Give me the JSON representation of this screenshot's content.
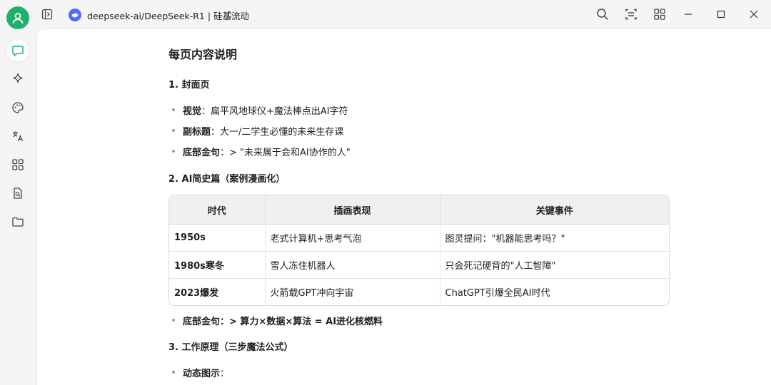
{
  "header": {
    "model_name": "deepseek-ai/DeepSeek-R1 | 硅基流动"
  },
  "doc": {
    "title": "每页内容说明",
    "section1": {
      "heading": "1. 封面页",
      "bullets": [
        {
          "label": "视觉",
          "text": "：扁平风地球仪+魔法棒点出AI字符"
        },
        {
          "label": "副标题",
          "text": "：大一/二学生必懂的未来生存课"
        },
        {
          "label": "底部金句",
          "text": "：> \"未来属于会和AI协作的人\""
        }
      ]
    },
    "section2": {
      "heading": "2. AI简史篇（案例漫画化）",
      "table": {
        "headers": [
          "时代",
          "插画表现",
          "关键事件"
        ],
        "rows": [
          [
            "1950s",
            "老式计算机+思考气泡",
            "图灵提问：\"机器能思考吗？\""
          ],
          [
            "1980s寒冬",
            "雪人冻住机器人",
            "只会死记硬背的\"人工智障\""
          ],
          [
            "2023爆发",
            "火箭载GPT冲向宇宙",
            "ChatGPT引爆全民AI时代"
          ]
        ]
      },
      "bullet": {
        "label": "底部金句",
        "text": "：> 算力×数据×算法 = AI进化核燃料"
      }
    },
    "section3": {
      "heading": "3. 工作原理（三步魔法公式）",
      "bullet": {
        "label": "动态图示",
        "text": "："
      }
    }
  },
  "colors": {
    "accent": "#1fb16a",
    "model_logo": "#4d6bfe"
  }
}
